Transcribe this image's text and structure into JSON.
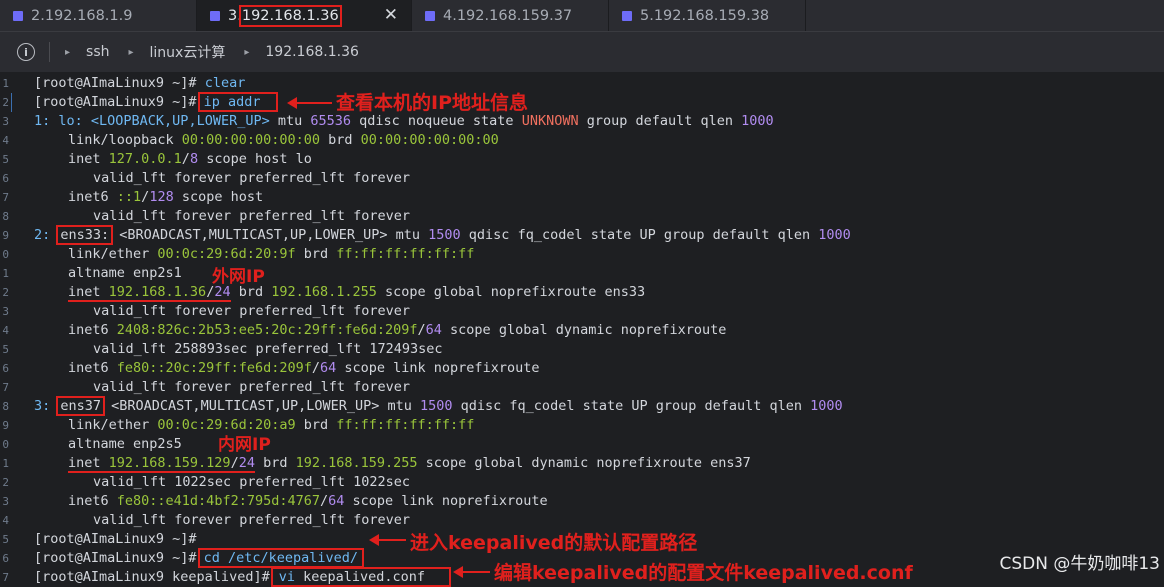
{
  "tabs": [
    {
      "label": "2.192.168.1.9"
    },
    {
      "prefix": "3.",
      "label": "192.168.1.36"
    },
    {
      "label": "4.192.168.159.37"
    },
    {
      "label": "5.192.168.159.38"
    }
  ],
  "tab_close_glyph": "✕",
  "breadcrumb": {
    "info_glyph": "i",
    "items": [
      "ssh",
      "linux云计算",
      "192.168.1.36"
    ]
  },
  "terminal": {
    "gutter": [
      "1",
      "2",
      "3",
      "4",
      "5",
      "6",
      "7",
      "8",
      "9",
      "0",
      "1",
      "2",
      "3",
      "4",
      "5",
      "6",
      "7",
      "8",
      "9",
      "0",
      "1",
      "2",
      "3",
      "4",
      "5",
      "6",
      "7"
    ],
    "l1": {
      "prompt": "[root@AImaLinux9 ~]#",
      "cmd": " clear"
    },
    "l2": {
      "prompt": "[root@AImaLinux9 ~]#",
      "cmd": "ip addr"
    },
    "l3": {
      "a": "1: lo: ",
      "b": "<LOOPBACK,UP,LOWER_UP>",
      "c": " mtu ",
      "d": "65536",
      "e": " qdisc noqueue state ",
      "f": "UNKNOWN",
      "g": " group default qlen ",
      "h": "1000"
    },
    "l4": {
      "a": "link/loopback ",
      "b": "00:00:00:00:00:00",
      "c": " brd ",
      "d": "00:00:00:00:00:00"
    },
    "l5": {
      "a": "inet ",
      "b": "127.0.0.1",
      "c": "/",
      "d": "8",
      "e": " scope host lo"
    },
    "l6": {
      "a": "valid_lft forever preferred_lft forever"
    },
    "l7": {
      "a": "inet6 ",
      "b": "::1",
      "c": "/",
      "d": "128",
      "e": " scope host"
    },
    "l8": {
      "a": "valid_lft forever preferred_lft forever"
    },
    "l9": {
      "a": "2: ",
      "b": "ens33:",
      "c": " <BROADCAST,MULTICAST,UP,LOWER_UP>",
      "d": " mtu ",
      "e": "1500",
      "f": " qdisc fq_codel state UP group default qlen ",
      "g": "1000"
    },
    "l10": {
      "a": "link/ether ",
      "b": "00:0c:29:6d:20:9f",
      "c": " brd ",
      "d": "ff:ff:ff:ff:ff:ff"
    },
    "l11": {
      "a": "altname enp2s1"
    },
    "l12": {
      "a": "inet ",
      "b": "192.168.1.36",
      "c": "/",
      "d": "24",
      "e": " brd ",
      "f": "192.168.1.255",
      "g": " scope global noprefixroute ens33"
    },
    "l13": {
      "a": "valid_lft forever preferred_lft forever"
    },
    "l14": {
      "a": "inet6 ",
      "b": "2408:826c:2b53:ee5:20c:29ff:fe6d:209f",
      "c": "/",
      "d": "64",
      "e": " scope global dynamic noprefixroute"
    },
    "l15": {
      "a": "valid_lft 258893sec preferred_lft 172493sec"
    },
    "l16": {
      "a": "inet6 ",
      "b": "fe80::20c:29ff:fe6d:209f",
      "c": "/",
      "d": "64",
      "e": " scope link noprefixroute"
    },
    "l17": {
      "a": "valid_lft forever preferred_lft forever"
    },
    "l18": {
      "a": "3: ",
      "b": "ens37",
      "c": " <BROADCAST,MULTICAST,UP,LOWER_UP>",
      "d": " mtu ",
      "e": "1500",
      "f": " qdisc fq_codel state UP group default qlen ",
      "g": "1000"
    },
    "l19": {
      "a": "link/ether ",
      "b": "00:0c:29:6d:20:a9",
      "c": " brd ",
      "d": "ff:ff:ff:ff:ff:ff"
    },
    "l20": {
      "a": "altname enp2s5"
    },
    "l21": {
      "a": "inet ",
      "b": "192.168.159.129",
      "c": "/",
      "d": "24",
      "e": " brd ",
      "f": "192.168.159.255",
      "g": " scope global dynamic noprefixroute ens37"
    },
    "l22": {
      "a": "valid_lft 1022sec preferred_lft 1022sec"
    },
    "l23": {
      "a": "inet6 ",
      "b": "fe80::e41d:4bf2:795d:4767",
      "c": "/",
      "d": "64",
      "e": " scope link noprefixroute"
    },
    "l24": {
      "a": "valid_lft forever preferred_lft forever"
    },
    "l25": {
      "prompt": "[root@AImaLinux9 ~]#"
    },
    "l26": {
      "prompt": "[root@AImaLinux9 ~]#",
      "cmd": "cd /etc/keepalived/"
    },
    "l27": {
      "prompt": "[root@AImaLinux9 keepalived]#",
      "cmd": "vi",
      "arg": " keepalived.conf"
    }
  },
  "annotations": {
    "ip_addr": "查看本机的IP地址信息",
    "wan": "外网IP",
    "lan": "内网IP",
    "cd": "进入keepalived的默认配置路径",
    "vi": "编辑keepalived的配置文件keepalived.conf"
  },
  "watermark": "CSDN @牛奶咖啡13",
  "colors": {
    "annotation_red": "#e0201d",
    "command_blue": "#6fb8f2",
    "number_purple": "#b18cf0",
    "mac_green": "#9ac53b",
    "unknown_red": "#f0705f",
    "tab_square": "#6e6cf7"
  }
}
